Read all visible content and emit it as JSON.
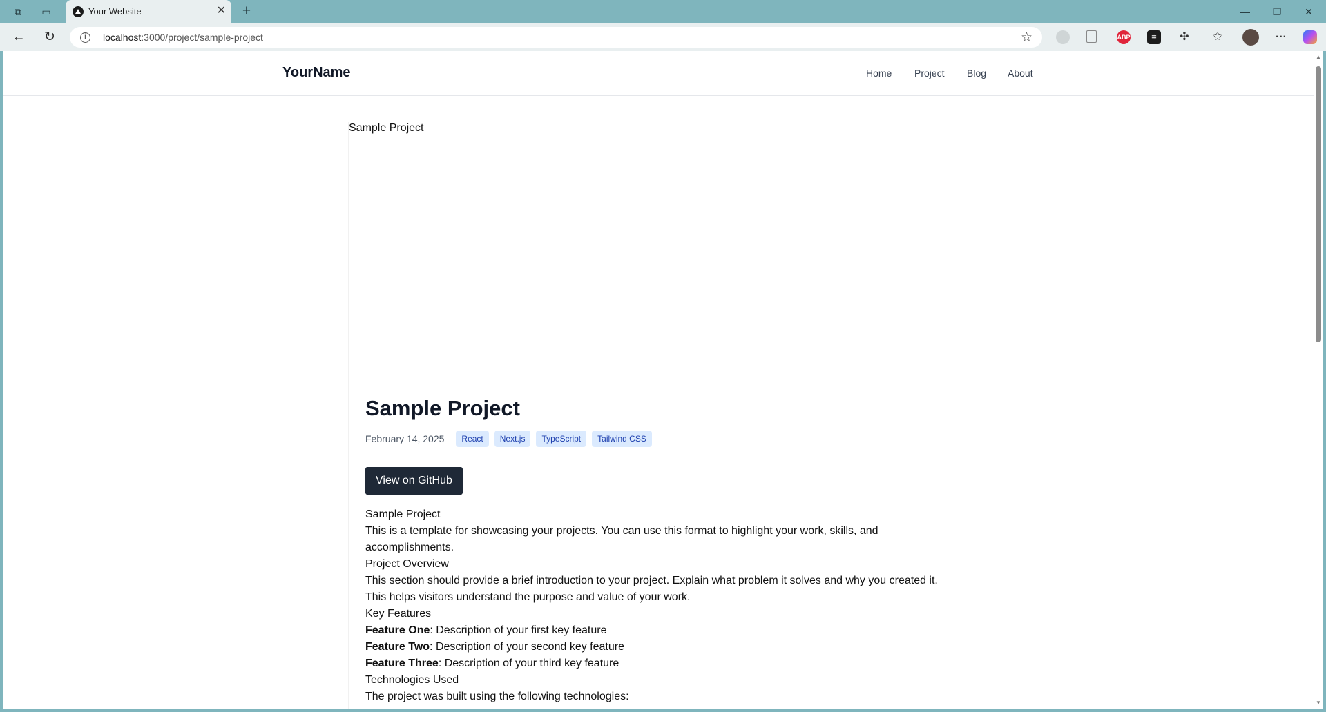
{
  "browser": {
    "tab_title": "Your Website",
    "url_host": "localhost",
    "url_path": ":3000/project/sample-project"
  },
  "site": {
    "logo": "YourName",
    "nav": [
      "Home",
      "Project",
      "Blog",
      "About"
    ]
  },
  "project": {
    "image_alt": "Sample Project",
    "title": "Sample Project",
    "date": "February 14, 2025",
    "tags": [
      "React",
      "Next.js",
      "TypeScript",
      "Tailwind CSS"
    ],
    "github_button": "View on GitHub",
    "content": {
      "heading1": "Sample Project",
      "intro": "This is a template for showcasing your projects. You can use this format to highlight your work, skills, and accomplishments.",
      "heading2": "Project Overview",
      "overview": "This section should provide a brief introduction to your project. Explain what problem it solves and why you created it. This helps visitors understand the purpose and value of your work.",
      "heading3": "Key Features",
      "features": [
        {
          "name": "Feature One",
          "desc": ": Description of your first key feature"
        },
        {
          "name": "Feature Two",
          "desc": ": Description of your second key feature"
        },
        {
          "name": "Feature Three",
          "desc": ": Description of your third key feature"
        }
      ],
      "heading4": "Technologies Used",
      "tech_intro": "The project was built using the following technologies:"
    }
  },
  "icons": {
    "extensions": [
      "profile-circle-icon",
      "pdf-icon",
      "adblock-plus-icon",
      "capture-icon",
      "extensions-puzzle-icon",
      "favorites-icon",
      "user-avatar",
      "more-icon",
      "copilot-icon"
    ],
    "adblock_color": "#e0243a"
  }
}
